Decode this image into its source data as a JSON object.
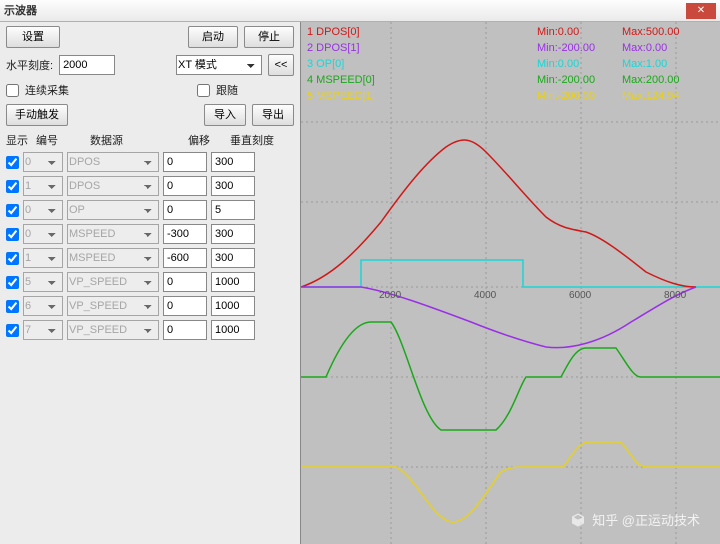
{
  "title": "示波器",
  "toolbar": {
    "settings": "设置",
    "start": "启动",
    "stop": "停止",
    "h_scale_label": "水平刻度:",
    "h_scale_value": "2000",
    "mode": "XT 模式",
    "mode_btn": "<<",
    "continuous": "连续采集",
    "follow": "跟随",
    "manual_trigger": "手动触发",
    "import": "导入",
    "export": "导出"
  },
  "headers": {
    "show": "显示",
    "number": "编号",
    "source": "数据源",
    "offset": "偏移",
    "v_scale": "垂直刻度"
  },
  "channels": [
    {
      "show": true,
      "num": "0",
      "src": "DPOS",
      "off": "0",
      "vs": "300",
      "dis": true
    },
    {
      "show": true,
      "num": "1",
      "src": "DPOS",
      "off": "0",
      "vs": "300",
      "dis": true
    },
    {
      "show": true,
      "num": "0",
      "src": "OP",
      "off": "0",
      "vs": "5",
      "dis": true
    },
    {
      "show": true,
      "num": "0",
      "src": "MSPEED",
      "off": "-300",
      "vs": "300",
      "dis": true
    },
    {
      "show": true,
      "num": "1",
      "src": "MSPEED",
      "off": "-600",
      "vs": "300",
      "dis": true
    },
    {
      "show": true,
      "num": "5",
      "src": "VP_SPEED",
      "off": "0",
      "vs": "1000",
      "dis": true
    },
    {
      "show": true,
      "num": "6",
      "src": "VP_SPEED",
      "off": "0",
      "vs": "1000",
      "dis": true
    },
    {
      "show": true,
      "num": "7",
      "src": "VP_SPEED",
      "off": "0",
      "vs": "1000",
      "dis": true
    }
  ],
  "legend": [
    {
      "name": "1 DPOS[0]",
      "min": "Min:0.00",
      "max": "Max:500.00",
      "color": "#d01818"
    },
    {
      "name": "2 DPOS[1]",
      "min": "Min:-200.00",
      "max": "Max:0.00",
      "color": "#9a2fe6"
    },
    {
      "name": "3 OP[0]",
      "min": "Min:0.00",
      "max": "Max:1.00",
      "color": "#18d6d6"
    },
    {
      "name": "4 MSPEED[0]",
      "min": "Min:-200.00",
      "max": "Max:200.00",
      "color": "#1aa81a"
    },
    {
      "name": "5 MSPEED[1]",
      "min": "Min:-200.00",
      "max": "Max:124.94",
      "color": "#e6d020"
    }
  ],
  "axis": {
    "x2000": "2000",
    "x4000": "4000",
    "x6000": "6000",
    "x8000": "8000"
  },
  "watermark": "知乎 @正运动技术",
  "chart_data": {
    "type": "line",
    "xlabel": "",
    "ylabel": "",
    "xlim": [
      0,
      8800
    ],
    "note": "Oscilloscope traces; y values are screen units relative to each channel offset/scale.",
    "series": [
      {
        "name": "DPOS[0]",
        "color": "#d01818",
        "points": [
          [
            0,
            0
          ],
          [
            500,
            20
          ],
          [
            1000,
            60
          ],
          [
            1500,
            110
          ],
          [
            2000,
            160
          ],
          [
            2600,
            200
          ],
          [
            3150,
            210
          ],
          [
            3700,
            195
          ],
          [
            4200,
            175
          ],
          [
            4900,
            155
          ],
          [
            5400,
            150
          ],
          [
            5900,
            140
          ],
          [
            6600,
            110
          ],
          [
            7500,
            50
          ],
          [
            8200,
            0
          ]
        ]
      },
      {
        "name": "DPOS[1]",
        "color": "#9a2fe6",
        "points": [
          [
            0,
            0
          ],
          [
            1400,
            0
          ],
          [
            2000,
            -8
          ],
          [
            3000,
            -25
          ],
          [
            4000,
            -45
          ],
          [
            4800,
            -60
          ],
          [
            5500,
            -75
          ],
          [
            6500,
            -60
          ],
          [
            7500,
            -30
          ],
          [
            8200,
            0
          ]
        ]
      },
      {
        "name": "OP[0]",
        "color": "#18d6d6",
        "points": [
          [
            0,
            0
          ],
          [
            1400,
            0
          ],
          [
            1400,
            30
          ],
          [
            4800,
            30
          ],
          [
            4800,
            0
          ],
          [
            8800,
            0
          ]
        ]
      },
      {
        "name": "MSPEED[0]",
        "color": "#1aa81a",
        "points": [
          [
            0,
            0
          ],
          [
            600,
            0
          ],
          [
            1200,
            60
          ],
          [
            1900,
            60
          ],
          [
            2800,
            -55
          ],
          [
            3400,
            -55
          ],
          [
            4200,
            -55
          ],
          [
            4800,
            0
          ],
          [
            5600,
            0
          ],
          [
            5800,
            30
          ],
          [
            6600,
            30
          ],
          [
            7200,
            0
          ],
          [
            8200,
            0
          ]
        ]
      },
      {
        "name": "MSPEED[1]",
        "color": "#e6d020",
        "points": [
          [
            0,
            0
          ],
          [
            1500,
            0
          ],
          [
            2200,
            0
          ],
          [
            2800,
            -45
          ],
          [
            3600,
            -50
          ],
          [
            4300,
            -10
          ],
          [
            4800,
            0
          ],
          [
            5600,
            0
          ],
          [
            5900,
            25
          ],
          [
            6700,
            25
          ],
          [
            7400,
            0
          ],
          [
            8200,
            0
          ]
        ]
      }
    ]
  }
}
